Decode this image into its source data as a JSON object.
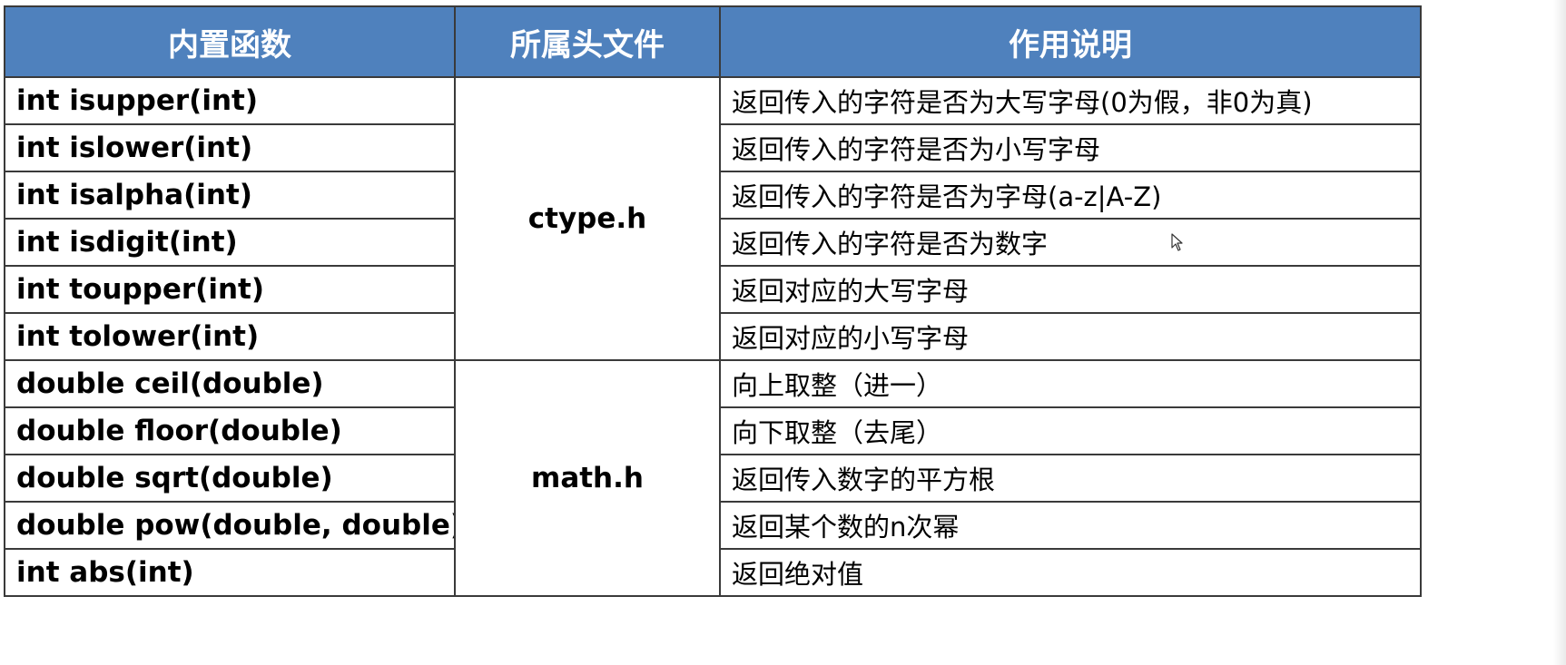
{
  "table": {
    "headers": [
      "内置函数",
      "所属头文件",
      "作用说明"
    ],
    "groups": [
      {
        "header_file": "ctype.h",
        "rows": [
          {
            "func": "int isupper(int)",
            "desc": "返回传入的字符是否为大写字母(0为假，非0为真)"
          },
          {
            "func": "int islower(int)",
            "desc": "返回传入的字符是否为小写字母"
          },
          {
            "func": "int isalpha(int)",
            "desc": "返回传入的字符是否为字母(a-z|A-Z)"
          },
          {
            "func": "int isdigit(int)",
            "desc": "返回传入的字符是否为数字"
          },
          {
            "func": "int toupper(int)",
            "desc": "返回对应的大写字母"
          },
          {
            "func": "int tolower(int)",
            "desc": "返回对应的小写字母"
          }
        ]
      },
      {
        "header_file": "math.h",
        "rows": [
          {
            "func": "double ceil(double)",
            "desc": "向上取整（进一）"
          },
          {
            "func": "double floor(double)",
            "desc": "向下取整（去尾）"
          },
          {
            "func": "double sqrt(double)",
            "desc": "返回传入数字的平方根"
          },
          {
            "func": "double pow(double, double)",
            "desc": "返回某个数的n次幂"
          },
          {
            "func": "int abs(int)",
            "desc": "返回绝对值"
          }
        ]
      }
    ]
  },
  "colors": {
    "header_bg": "#4f81bd",
    "header_text": "#ffffff",
    "border": "#3a3a3a"
  },
  "icons": {
    "cursor": "mouse-pointer-icon"
  }
}
